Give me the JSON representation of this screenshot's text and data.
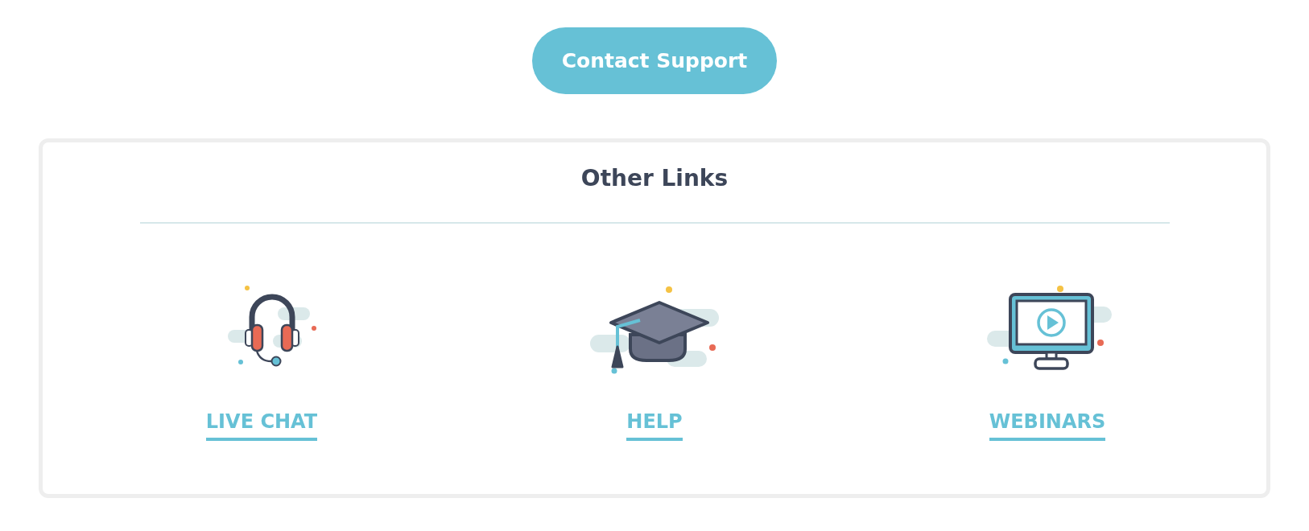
{
  "contact_button": {
    "label": "Contact Support"
  },
  "other_links": {
    "title": "Other Links",
    "links": [
      {
        "kind": "headset",
        "label": "LIVE CHAT"
      },
      {
        "kind": "cap",
        "label": "HELP"
      },
      {
        "kind": "monitor",
        "label": "WEBINARS"
      }
    ]
  }
}
